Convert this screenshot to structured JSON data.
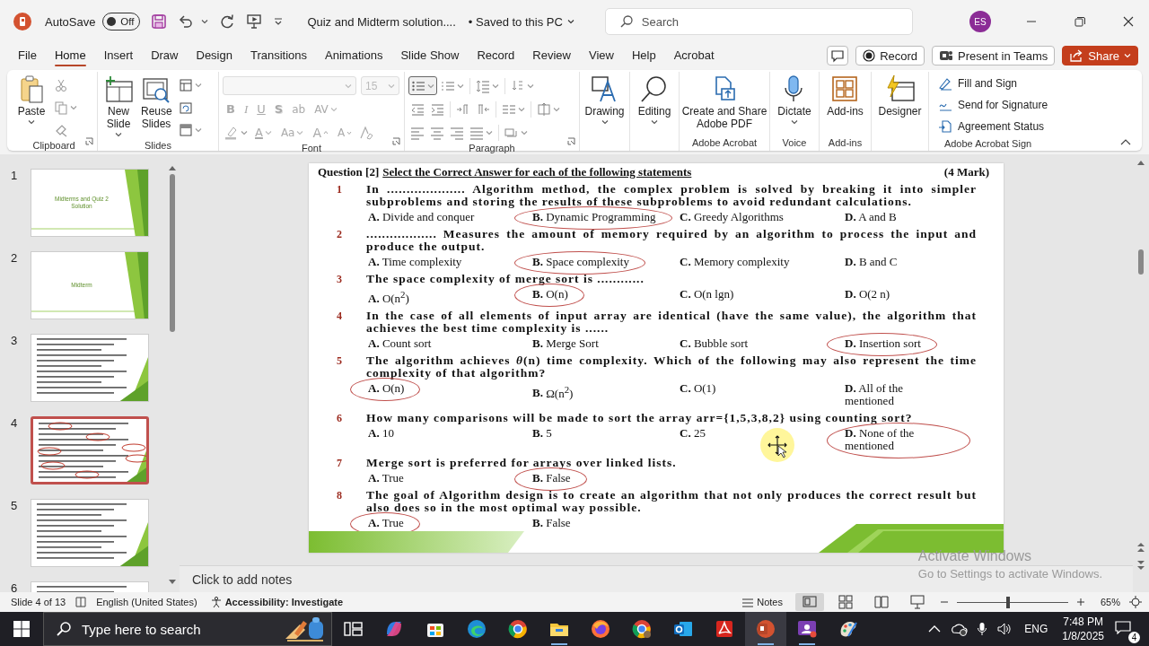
{
  "title_bar": {
    "autosave_label": "AutoSave",
    "autosave": {
      "on": false,
      "label": "Off"
    },
    "document_title": "Quiz and Midterm solution....",
    "save_status": "• Saved to this PC",
    "search": {
      "placeholder": "Search"
    },
    "account_initials": "ES"
  },
  "ribbon_tabs": [
    {
      "label": "File",
      "selected": false
    },
    {
      "label": "Home",
      "selected": true
    },
    {
      "label": "Insert",
      "selected": false
    },
    {
      "label": "Draw",
      "selected": false
    },
    {
      "label": "Design",
      "selected": false
    },
    {
      "label": "Transitions",
      "selected": false
    },
    {
      "label": "Animations",
      "selected": false
    },
    {
      "label": "Slide Show",
      "selected": false
    },
    {
      "label": "Record",
      "selected": false
    },
    {
      "label": "Review",
      "selected": false
    },
    {
      "label": "View",
      "selected": false
    },
    {
      "label": "Help",
      "selected": false
    },
    {
      "label": "Acrobat",
      "selected": false
    }
  ],
  "header_buttons": [
    {
      "kind": "comments"
    },
    {
      "kind": "record",
      "label": "Record"
    },
    {
      "kind": "present",
      "label": "Present in Teams"
    },
    {
      "kind": "share",
      "label": "Share"
    }
  ],
  "ribbon_groups": [
    {
      "kind": "clipboard",
      "name": "Clipboard",
      "launcher": true,
      "buttons": [
        {
          "label": "Paste",
          "dropdown": true
        }
      ]
    },
    {
      "kind": "slides",
      "name": "Slides",
      "launcher": false,
      "buttons": [
        {
          "label": "New Slide",
          "dropdown": true
        },
        {
          "label": "Reuse Slides",
          "dropdown": false
        }
      ]
    },
    {
      "kind": "font",
      "name": "Font",
      "launcher": true,
      "font_size": "15",
      "row1": [
        "B",
        "I",
        "U",
        "S",
        "ab",
        "AV"
      ],
      "row2": [
        "A",
        "Aa",
        "A",
        "A"
      ]
    },
    {
      "kind": "paragraph",
      "name": "Paragraph",
      "launcher": true
    },
    {
      "kind": "drawing",
      "launcher": false,
      "buttons": [
        {
          "label": "Drawing",
          "dropdown": true
        }
      ]
    },
    {
      "kind": "editing",
      "launcher": false,
      "buttons": [
        {
          "label": "Editing",
          "dropdown": true
        }
      ]
    },
    {
      "kind": "acrobat",
      "name": "Adobe Acrobat",
      "launcher": false,
      "buttons": [
        {
          "label": "Create and Share Adobe PDF",
          "dropdown": false
        }
      ]
    },
    {
      "kind": "voice",
      "name": "Voice",
      "launcher": false,
      "buttons": [
        {
          "label": "Dictate",
          "dropdown": true
        }
      ]
    },
    {
      "kind": "addins",
      "name": "Add-ins",
      "launcher": false,
      "buttons": [
        {
          "label": "Add-ins",
          "dropdown": false
        }
      ]
    },
    {
      "kind": "designer",
      "launcher": false,
      "buttons": [
        {
          "label": "Designer",
          "dropdown": false
        }
      ]
    },
    {
      "kind": "sign",
      "name": "Adobe Acrobat Sign",
      "launcher": false,
      "buttons": [
        {
          "label": "Fill and Sign"
        },
        {
          "label": "Send for Signature"
        },
        {
          "label": "Agreement Status"
        }
      ]
    }
  ],
  "thumbnails": [
    {
      "number": "1",
      "kind": "title",
      "title": "Midterms and Quiz 2 Solution",
      "selected": false
    },
    {
      "number": "2",
      "kind": "title",
      "title": "Midterm",
      "selected": false
    },
    {
      "number": "3",
      "kind": "document",
      "annotated": false,
      "selected": false
    },
    {
      "number": "4",
      "kind": "document",
      "annotated": true,
      "selected": true
    },
    {
      "number": "5",
      "kind": "document",
      "annotated": false,
      "selected": false
    },
    {
      "number": "6",
      "kind": "document",
      "annotated": false,
      "selected": false
    }
  ],
  "slide": {
    "heading": {
      "label": "Question [2]",
      "title": "Select the Correct Answer for each of the following statements",
      "marks": "(4 Mark)"
    },
    "questions": [
      {
        "number": "1",
        "text": "In .................... Algorithm method, the complex problem is solved by breaking it into simpler subproblems and storing the results of these subproblems to avoid redundant calculations.",
        "options": [
          {
            "letter": "A.",
            "text": "Divide and conquer",
            "selected": false
          },
          {
            "letter": "B.",
            "text": "Dynamic Programming",
            "selected": true
          },
          {
            "letter": "C.",
            "text": "Greedy Algorithms",
            "selected": false
          },
          {
            "letter": "D.",
            "text": "A and B",
            "selected": false
          }
        ]
      },
      {
        "number": "2",
        "text": ".................. Measures the amount of memory required by an algorithm to process the input and produce the output.",
        "options": [
          {
            "letter": "A.",
            "text": "Time complexity",
            "selected": false
          },
          {
            "letter": "B.",
            "text": "Space complexity",
            "selected": true
          },
          {
            "letter": "C.",
            "text": "Memory complexity",
            "selected": false
          },
          {
            "letter": "D.",
            "text": "B and C",
            "selected": false
          }
        ]
      },
      {
        "number": "3",
        "text": "The space complexity of merge sort is ............",
        "options": [
          {
            "letter": "A.",
            "text": "O(n$^{2}$)",
            "selected": false
          },
          {
            "letter": "B.",
            "text": "O(n)",
            "selected": true
          },
          {
            "letter": "C.",
            "text": "O(n lgn)",
            "selected": false
          },
          {
            "letter": "D.",
            "text": "O(2 n)",
            "selected": false
          }
        ]
      },
      {
        "number": "4",
        "text": "In the case of all elements of input array are identical (have the same value), the algorithm that achieves the best time complexity is ......",
        "options": [
          {
            "letter": "A.",
            "text": "Count sort",
            "selected": false
          },
          {
            "letter": "B.",
            "text": "Merge Sort",
            "selected": false
          },
          {
            "letter": "C.",
            "text": "Bubble sort",
            "selected": false
          },
          {
            "letter": "D.",
            "text": "Insertion sort",
            "selected": true
          }
        ]
      },
      {
        "number": "5",
        "text": "The algorithm achieves *θ*(n) time complexity. Which of the following may also represent the time complexity of that algorithm?",
        "options": [
          {
            "letter": "A.",
            "text": "O(n)",
            "selected": true
          },
          {
            "letter": "B.",
            "text": "Ω(n$^{2}$)",
            "selected": false
          },
          {
            "letter": "C.",
            "text": "O(1)",
            "selected": false
          },
          {
            "letter": "D.",
            "text": "All of the mentioned",
            "selected": false
          }
        ]
      },
      {
        "number": "6",
        "text": "How many comparisons will be made to sort the array arr={1,5,3,8,2} using counting sort?",
        "options": [
          {
            "letter": "A.",
            "text": "10",
            "selected": false
          },
          {
            "letter": "B.",
            "text": "5",
            "selected": false
          },
          {
            "letter": "C.",
            "text": "25",
            "selected": false
          },
          {
            "letter": "D.",
            "text": "None of the mentioned",
            "selected": true
          }
        ]
      },
      {
        "number": "7",
        "text": "Merge sort is preferred for arrays over linked lists.",
        "options": [
          {
            "letter": "A.",
            "text": "True",
            "selected": false
          },
          {
            "letter": "B.",
            "text": "False",
            "selected": true
          }
        ]
      },
      {
        "number": "8",
        "text": "The goal of Algorithm design is to create an algorithm that not only produces the correct result but also does so in the most optimal way possible.",
        "options": [
          {
            "letter": "A.",
            "text": "True",
            "selected": true
          },
          {
            "letter": "B.",
            "text": "False",
            "selected": false
          }
        ]
      }
    ]
  },
  "notes": {
    "placeholder": "Click to add notes"
  },
  "activation": {
    "title": "Activate Windows",
    "message": "Go to Settings to activate Windows."
  },
  "status_bar": {
    "slide_position": "Slide 4 of 13",
    "language": "English (United States)",
    "accessibility": "Accessibility: Investigate",
    "notes_label": "Notes",
    "views": [
      {
        "selected": true
      },
      {
        "selected": false
      },
      {
        "selected": false
      },
      {
        "selected": false
      }
    ],
    "zoom": {
      "level": 0.46,
      "label": "65%"
    }
  },
  "taskbar": {
    "search": {
      "placeholder": "Type here to search"
    },
    "apps": [
      {
        "running": false,
        "active": false
      },
      {
        "running": false,
        "active": false
      },
      {
        "running": false,
        "active": false
      },
      {
        "running": false,
        "active": false
      },
      {
        "running": false,
        "active": false
      },
      {
        "running": true,
        "active": false
      },
      {
        "running": false,
        "active": false
      },
      {
        "running": false,
        "active": false
      },
      {
        "running": false,
        "active": false
      },
      {
        "running": false,
        "active": false
      },
      {
        "running": true,
        "active": true
      },
      {
        "running": true,
        "active": false
      },
      {
        "running": false,
        "active": false
      }
    ],
    "language": "ENG",
    "time": "7:48 PM",
    "date": "1/8/2025",
    "notifications": "4"
  }
}
